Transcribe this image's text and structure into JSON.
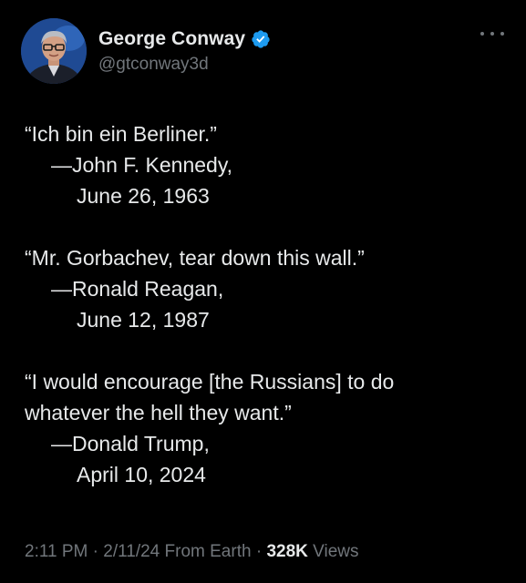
{
  "author": {
    "display_name": "George Conway",
    "handle": "@gtconway3d",
    "verified": true,
    "verified_color": "#1d9bf0",
    "avatar_icon": "profile-photo"
  },
  "menu_icon": "more-dots-icon",
  "tweet": {
    "quotes": [
      {
        "quote_lines": [
          "“Ich bin ein Berliner.”"
        ],
        "attribution": "—John F. Kennedy,",
        "date": "June 26, 1963"
      },
      {
        "quote_lines": [
          "“Mr. Gorbachev, tear down this wall.”"
        ],
        "attribution": "—Ronald Reagan,",
        "date": "June 12, 1987"
      },
      {
        "quote_lines": [
          "“I would encourage [the Russians] to do",
          "whatever the hell they want.”"
        ],
        "attribution": "—Donald Trump,",
        "date": "April 10, 2024"
      }
    ]
  },
  "meta": {
    "time": "2:11 PM",
    "date": "2/11/24",
    "source": "From Earth",
    "views_count": "328K",
    "views_label": "Views"
  },
  "colors": {
    "background": "#000000",
    "primary_text": "#e7e9ea",
    "secondary_text": "#71767b"
  }
}
